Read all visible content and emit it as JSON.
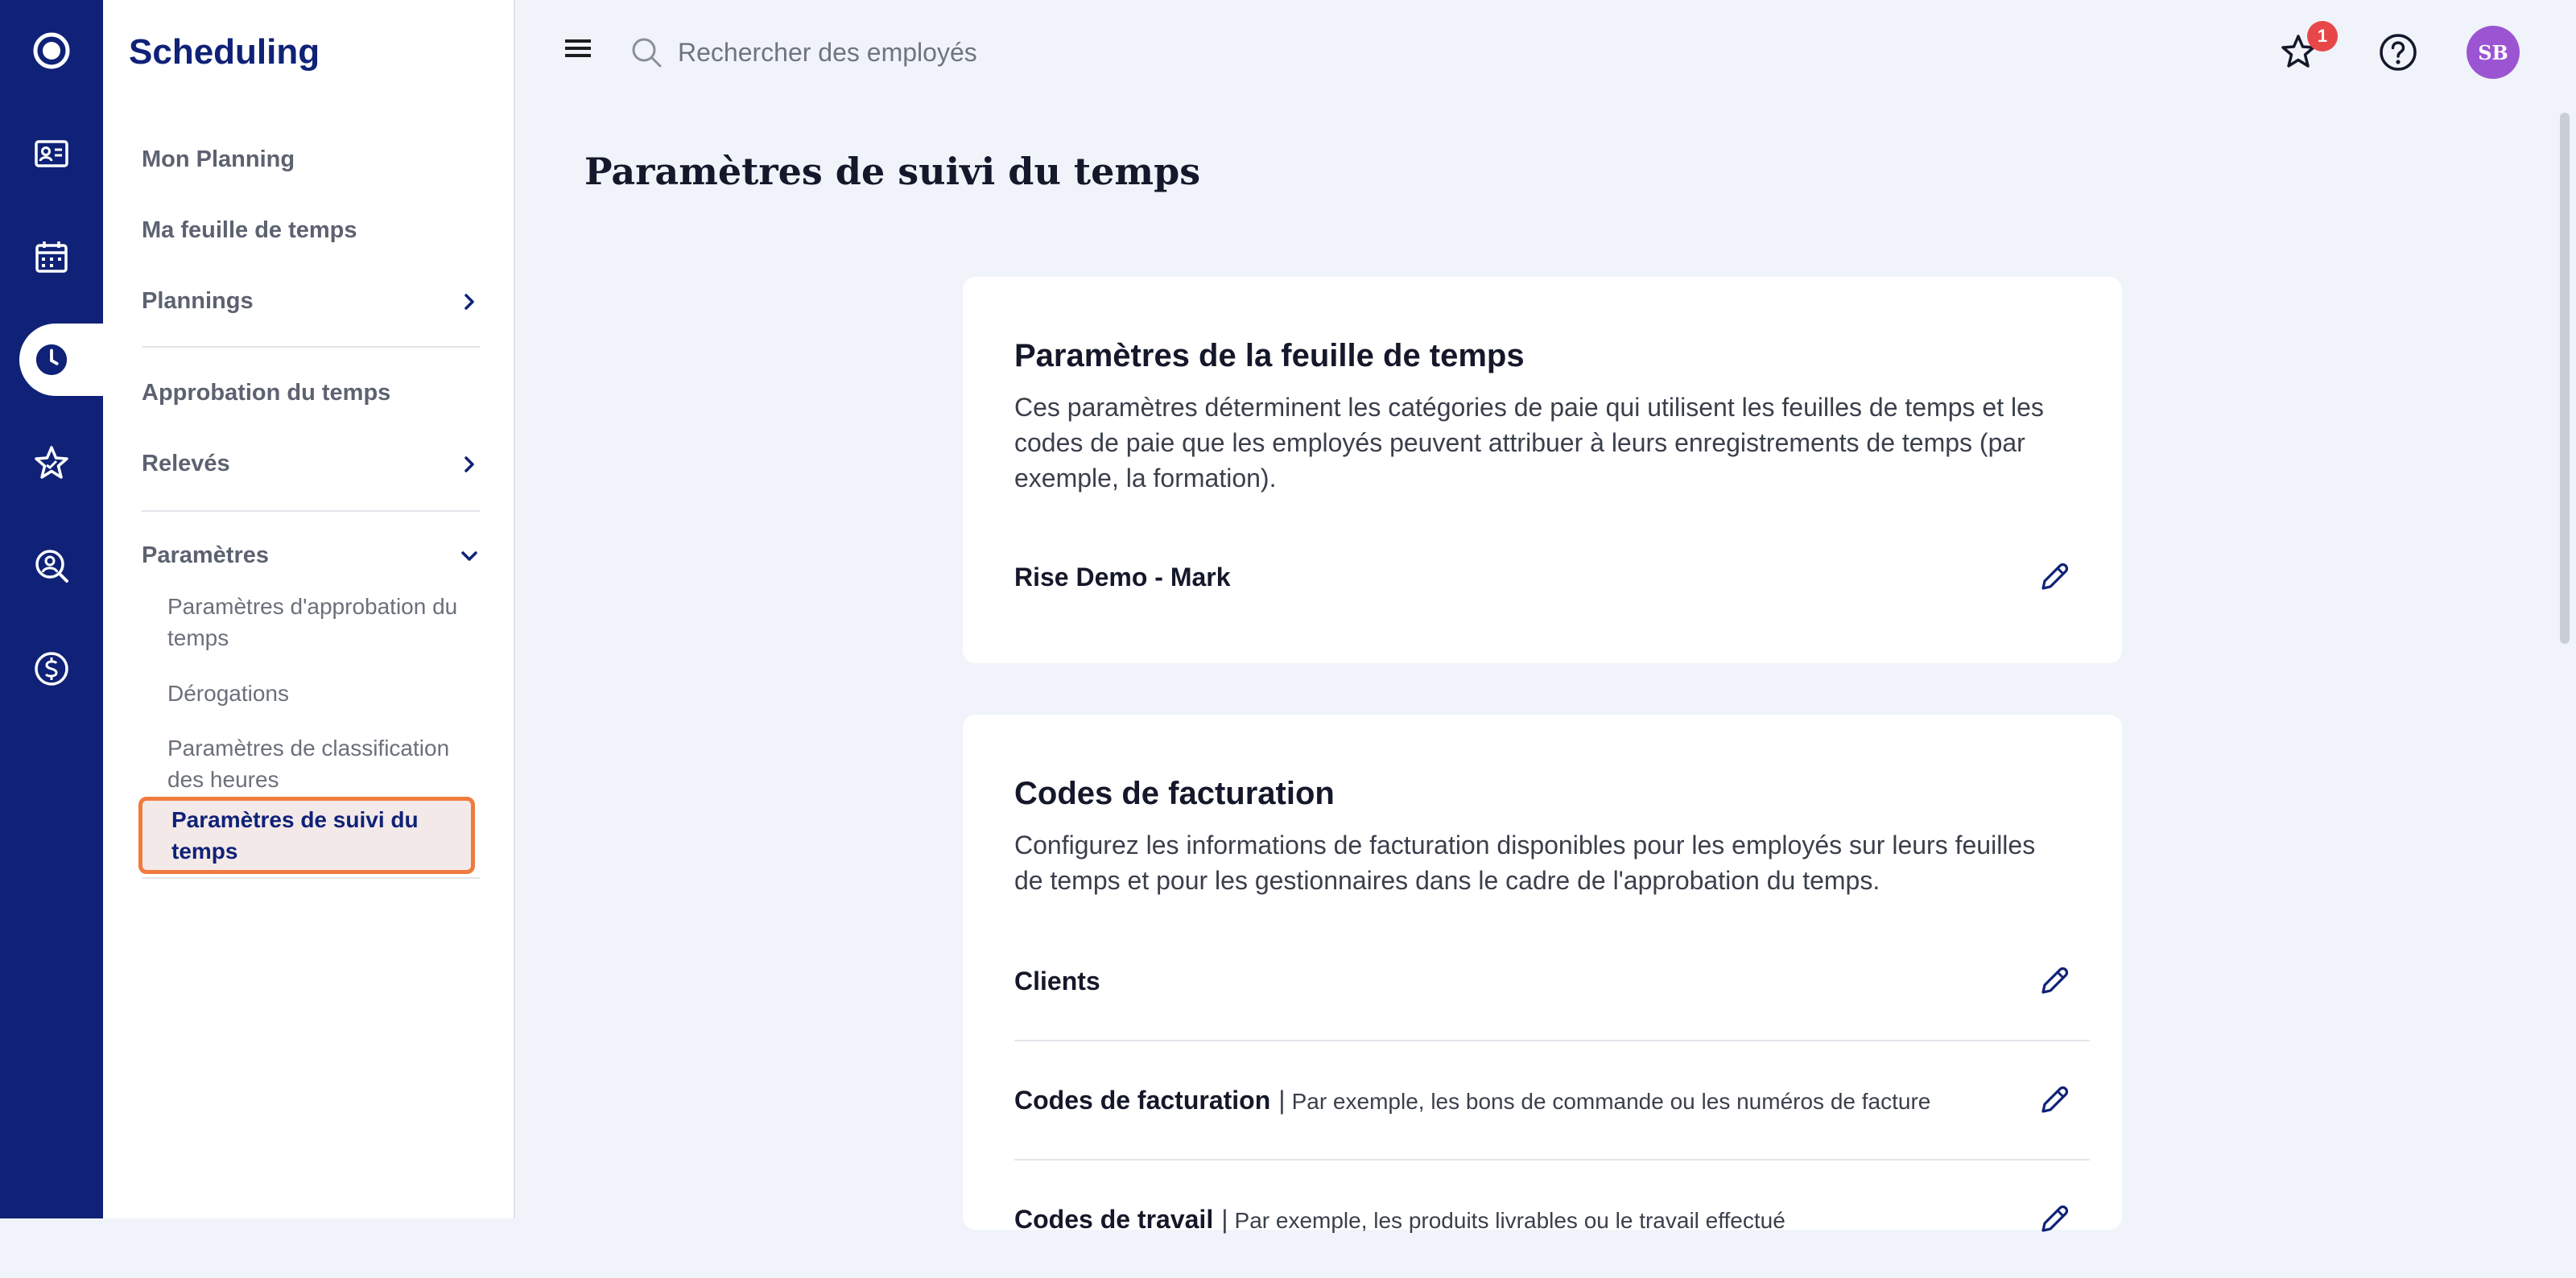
{
  "rail": {
    "items": [
      {
        "icon": "logo-circle-icon"
      },
      {
        "icon": "id-card-icon"
      },
      {
        "icon": "calendar-icon"
      },
      {
        "icon": "clock-icon",
        "active": true
      },
      {
        "icon": "star-icon"
      },
      {
        "icon": "search-person-icon"
      },
      {
        "icon": "dollar-icon"
      }
    ]
  },
  "sidebar": {
    "app_title": "Scheduling",
    "items": [
      {
        "label": "Mon Planning"
      },
      {
        "label": "Ma feuille de temps"
      },
      {
        "label": "Plannings",
        "has_chevron": true
      },
      {
        "label": "Approbation du temps"
      },
      {
        "label": "Relevés",
        "has_chevron": true
      },
      {
        "label": "Paramètres",
        "expanded": true
      }
    ],
    "sub_items": [
      {
        "label": "Paramètres d'approbation du temps"
      },
      {
        "label": "Dérogations"
      },
      {
        "label": "Paramètres de classification des heures"
      },
      {
        "label": "Paramètres de suivi du temps",
        "active": true
      }
    ]
  },
  "topbar": {
    "search_placeholder": "Rechercher des employés",
    "notification_count": "1",
    "avatar_initials": "SB"
  },
  "main": {
    "page_title": "Paramètres de suivi du temps",
    "cards": [
      {
        "title": "Paramètres de la feuille de temps",
        "description": "Ces paramètres déterminent les catégories de paie qui utilisent les feuilles de temps et les codes de paie que les employés peuvent attribuer à leurs enregistrements de temps (par exemple, la formation).",
        "rows": [
          {
            "label": "Rise Demo - Mark",
            "hint": ""
          }
        ]
      },
      {
        "title": "Codes de facturation",
        "description": "Configurez les informations de facturation disponibles pour les employés sur leurs feuilles de temps et pour les gestionnaires dans le cadre de l'approbation du temps.",
        "rows": [
          {
            "label": "Clients",
            "hint": ""
          },
          {
            "label": "Codes de facturation",
            "separator": "|",
            "hint": "Par exemple, les bons de commande ou les numéros de facture"
          },
          {
            "label": "Codes de travail",
            "separator": "|",
            "hint": "Par exemple, les produits livrables ou le travail effectué"
          }
        ]
      }
    ]
  },
  "colors": {
    "rail_bg": "#0f2277",
    "accent": "#0f2277",
    "highlight_border": "#f07b3e",
    "badge": "#e8474a",
    "avatar": "#9c55d2",
    "page_bg": "#f0f4fa"
  }
}
